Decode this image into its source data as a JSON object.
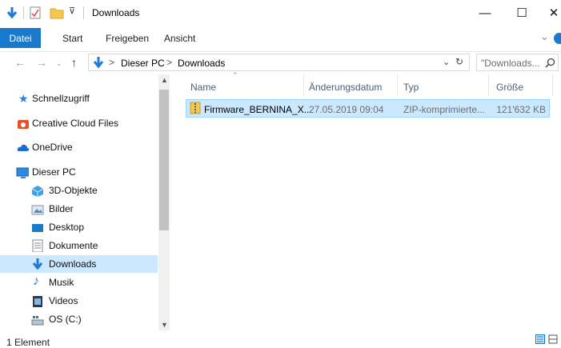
{
  "window": {
    "title": "Downloads",
    "minimize_glyph": "—",
    "maximize_glyph": "☐",
    "close_glyph": "✕"
  },
  "quick_access_toolbar": [
    "down-arrow-icon",
    "properties-icon",
    "new-folder-icon",
    "customize-toolbar-icon"
  ],
  "ribbon": {
    "tabs": [
      "Datei",
      "Start",
      "Freigeben",
      "Ansicht"
    ],
    "expand_glyph": "⌄"
  },
  "address_bar": {
    "path": [
      "Dieser PC",
      "Downloads"
    ],
    "separator": ">",
    "search_placeholder": "\"Downloads..."
  },
  "nav_pane": {
    "items": [
      {
        "label": "Schnellzugriff",
        "icon": "star-icon"
      },
      {
        "label": "Creative Cloud Files",
        "icon": "creative-cloud-icon"
      },
      {
        "label": "OneDrive",
        "icon": "cloud-icon"
      },
      {
        "label": "Dieser PC",
        "icon": "pc-icon"
      },
      {
        "label": "3D-Objekte",
        "icon": "cube-icon"
      },
      {
        "label": "Bilder",
        "icon": "pictures-icon"
      },
      {
        "label": "Desktop",
        "icon": "desktop-icon"
      },
      {
        "label": "Dokumente",
        "icon": "document-icon"
      },
      {
        "label": "Downloads",
        "icon": "download-icon",
        "selected": true
      },
      {
        "label": "Musik",
        "icon": "music-icon"
      },
      {
        "label": "Videos",
        "icon": "video-icon"
      },
      {
        "label": "OS (C:)",
        "icon": "drive-icon"
      }
    ]
  },
  "columns": [
    "Name",
    "Änderungsdatum",
    "Typ",
    "Größe"
  ],
  "files": [
    {
      "name": "Firmware_BERNINA_X...",
      "modified": "27.05.2019 09:04",
      "type": "ZIP-komprimierte...",
      "size": "121'632 KB"
    }
  ],
  "status": {
    "count_text": "1 Element"
  },
  "colors": {
    "accent": "#1979ca",
    "selection": "#cce8ff",
    "folder": "#f3c850"
  }
}
